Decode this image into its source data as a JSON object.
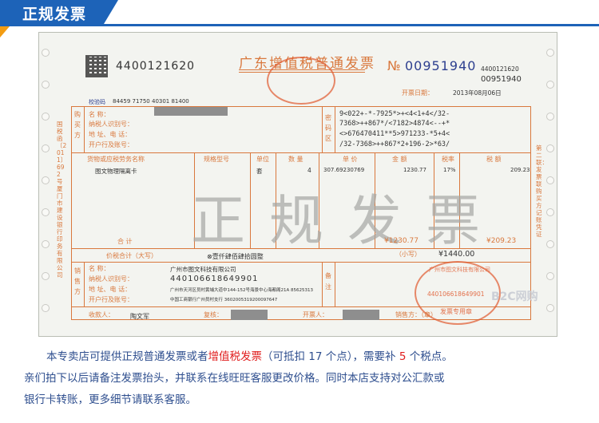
{
  "banner": {
    "title": "正规发票"
  },
  "invoice": {
    "code": "4400121620",
    "title": "广东增值税普通发票",
    "no_prefix": "№",
    "number": "00951940",
    "code_small": "4400121620",
    "number_small": "00951940",
    "date_label": "开票日期：",
    "date_value": "2013年08月06日",
    "check_code_label": "校验码",
    "check_code": "84459 71750 40301 81400",
    "buyer_label": "购买方",
    "buyer_fields": [
      "名      称：",
      "纳税人识别号：",
      "地 址、电 话：",
      "开户行及账号："
    ],
    "secret_label": "密码区",
    "secret_lines": [
      "9<022+-*-7925*>+<4<1+4</32-",
      "7368>++867*/<7182>4874<--+*",
      "<>676470411**5>971233-*5+4<",
      "/32-7368>++867*2+196-2>*63/"
    ],
    "columns": [
      "货物或应税劳务名称",
      "规格型号",
      "单位",
      "数 量",
      "单 价",
      "金 额",
      "税率",
      "税 额"
    ],
    "item": {
      "name": "图文物理隔离卡",
      "unit": "套",
      "qty": "4",
      "price": "307.69230769",
      "amount": "1230.77",
      "rate": "17%",
      "tax": "209.23"
    },
    "total_label": "合      计",
    "total_amount": "¥1230.77",
    "total_tax": "¥209.23",
    "grand_label": "价税合计（大写）",
    "grand_words": "⊗壹仟肆佰肆拾圆整",
    "grand_small_label": "（小写）",
    "grand_small": "¥1440.00",
    "seller_label": "销售方",
    "seller_fields": [
      "名      称：",
      "纳税人识别号：",
      "地 址、电 话：",
      "开户行及账号："
    ],
    "seller_name": "广州市图文科技有限公司",
    "seller_taxid": "440106618649901",
    "seller_addr": "广州市天河区员村黄埔大道中144-152号海景中心海都阁21A 85625313",
    "seller_bank": "中国工商银行广州员村支行 3602005319200097647",
    "remark_label": "备注",
    "payee_label": "收款人：",
    "reviewer_label": "复核：",
    "drawer_label": "开票人：",
    "drawer": "陶文军",
    "seller_stamp_label": "销售方：（章）",
    "stamp_text": "广州市图文科技有限公司",
    "stamp_id": "440106618649901",
    "stamp_bottom": "发票专用章",
    "side_left": "国税函〔2011〕692号厦门市建设银行印务有限公司",
    "side_right": "第二联：发票联 购买方记账凭证",
    "watermark": "正规发票",
    "b2c_mark": "B2C网购"
  },
  "notice": {
    "line1_a": "本专卖店可提供正规普通发票或者",
    "line1_b": "增值税发票",
    "line1_c": "（可抵扣 17 个点），需要补 ",
    "line1_d": "5",
    "line1_e": " 个税点。",
    "line2": "亲们拍下以后请备注发票抬头，并联系在线旺旺客服更改价格。同时本店支持对公汇款或",
    "line3": "银行卡转账，更多细节请联系客服。"
  },
  "colors": {
    "banner": "#1d63b8",
    "accent": "#f39c12",
    "notice_text": "#2f4f8f",
    "notice_red": "#e01e1e",
    "invoice_line": "#d9783d"
  }
}
